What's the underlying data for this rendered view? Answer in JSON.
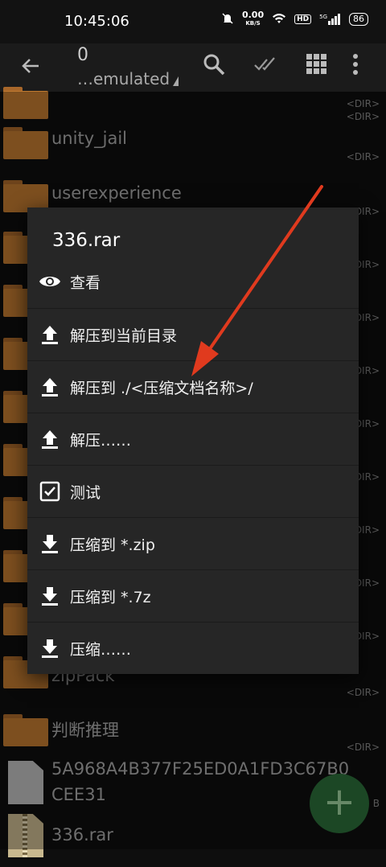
{
  "status_bar": {
    "time": "10:45:06",
    "speed_value": "0.00",
    "speed_unit": "KB/S",
    "hd": "HD",
    "network": "5G",
    "battery": "86"
  },
  "toolbar": {
    "title": "0",
    "path": "…emulated"
  },
  "files": [
    {
      "name": "unity_jail",
      "tag": "<DIR>"
    },
    {
      "name": "userexperience",
      "tag": "<DIR>"
    },
    {
      "name": "zipPack",
      "tag": "<DIR>"
    },
    {
      "name": "判断推理",
      "tag": "<DIR>"
    },
    {
      "name_line1": "5A968A4B377F25ED0A1FD3C67B0",
      "name_line2": "CEE31",
      "tag": "B"
    },
    {
      "name": "336.rar"
    }
  ],
  "dir_tags": [
    "<DIR>",
    "<DIR>",
    "<DIR>",
    "<DIR>",
    "<DIR>",
    "<DIR>",
    "<DIR>",
    "<DIR>",
    "<DIR>",
    "<DIR>",
    "<DIR>",
    "<DIR>",
    "<DIR>",
    "<DIR>"
  ],
  "dialog": {
    "title": "336.rar",
    "items": [
      {
        "label": "查看",
        "icon": "eye-icon"
      },
      {
        "label": "解压到当前目录",
        "icon": "upload-icon"
      },
      {
        "label": "解压到 ./<压缩文档名称>/",
        "icon": "upload-icon"
      },
      {
        "label": "解压……",
        "icon": "upload-icon"
      },
      {
        "label": "测试",
        "icon": "checkbox-icon"
      },
      {
        "label": "压缩到 *.zip",
        "icon": "download-icon"
      },
      {
        "label": "压缩到 *.7z",
        "icon": "download-icon"
      },
      {
        "label": "压缩……",
        "icon": "download-icon"
      }
    ]
  },
  "fab": {
    "label": "+"
  },
  "colors": {
    "folder": "#c07a31",
    "fab": "#2c6e3a",
    "arrow": "#e03a1e",
    "dialog": "#262626"
  }
}
